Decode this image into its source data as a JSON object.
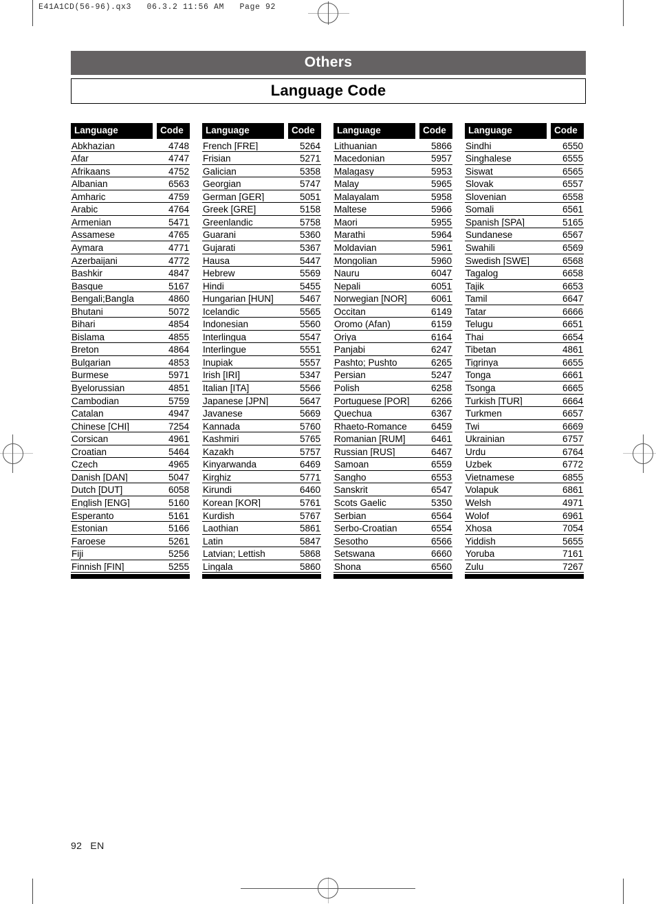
{
  "slug": "E41A1CD(56-96).qx3   06.3.2 11:56 AM   Page 92",
  "header": {
    "section_bar": "Others",
    "title_bar": "Language Code",
    "section_bar_color": "#656263"
  },
  "footer": {
    "page_number": "92",
    "language_code": "EN"
  },
  "table_headers": {
    "language": "Language",
    "code": "Code"
  },
  "columns": [
    {
      "rows": [
        {
          "language": "Abkhazian",
          "code": "4748"
        },
        {
          "language": "Afar",
          "code": "4747"
        },
        {
          "language": "Afrikaans",
          "code": "4752"
        },
        {
          "language": "Albanian",
          "code": "6563"
        },
        {
          "language": "Amharic",
          "code": "4759"
        },
        {
          "language": "Arabic",
          "code": "4764"
        },
        {
          "language": "Armenian",
          "code": "5471"
        },
        {
          "language": "Assamese",
          "code": "4765"
        },
        {
          "language": "Aymara",
          "code": "4771"
        },
        {
          "language": "Azerbaijani",
          "code": "4772"
        },
        {
          "language": "Bashkir",
          "code": "4847"
        },
        {
          "language": "Basque",
          "code": "5167"
        },
        {
          "language": "Bengali;Bangla",
          "code": "4860"
        },
        {
          "language": "Bhutani",
          "code": "5072"
        },
        {
          "language": "Bihari",
          "code": "4854"
        },
        {
          "language": "Bislama",
          "code": "4855"
        },
        {
          "language": "Breton",
          "code": "4864"
        },
        {
          "language": "Bulgarian",
          "code": "4853"
        },
        {
          "language": "Burmese",
          "code": "5971"
        },
        {
          "language": "Byelorussian",
          "code": "4851"
        },
        {
          "language": "Cambodian",
          "code": "5759"
        },
        {
          "language": "Catalan",
          "code": "4947"
        },
        {
          "language": "Chinese [CHI]",
          "code": "7254"
        },
        {
          "language": "Corsican",
          "code": "4961"
        },
        {
          "language": "Croatian",
          "code": "5464"
        },
        {
          "language": "Czech",
          "code": "4965"
        },
        {
          "language": "Danish [DAN]",
          "code": "5047"
        },
        {
          "language": "Dutch [DUT]",
          "code": "6058"
        },
        {
          "language": "English [ENG]",
          "code": "5160"
        },
        {
          "language": "Esperanto",
          "code": "5161"
        },
        {
          "language": "Estonian",
          "code": "5166"
        },
        {
          "language": "Faroese",
          "code": "5261"
        },
        {
          "language": "Fiji",
          "code": "5256"
        },
        {
          "language": "Finnish [FIN]",
          "code": "5255"
        }
      ]
    },
    {
      "rows": [
        {
          "language": "French [FRE]",
          "code": "5264"
        },
        {
          "language": "Frisian",
          "code": "5271"
        },
        {
          "language": "Galician",
          "code": "5358"
        },
        {
          "language": "Georgian",
          "code": "5747"
        },
        {
          "language": "German [GER]",
          "code": "5051"
        },
        {
          "language": "Greek [GRE]",
          "code": "5158"
        },
        {
          "language": "Greenlandic",
          "code": "5758"
        },
        {
          "language": "Guarani",
          "code": "5360"
        },
        {
          "language": "Gujarati",
          "code": "5367"
        },
        {
          "language": "Hausa",
          "code": "5447"
        },
        {
          "language": "Hebrew",
          "code": "5569"
        },
        {
          "language": "Hindi",
          "code": "5455"
        },
        {
          "language": "Hungarian [HUN]",
          "code": "5467"
        },
        {
          "language": "Icelandic",
          "code": "5565"
        },
        {
          "language": "Indonesian",
          "code": "5560"
        },
        {
          "language": "Interlingua",
          "code": "5547"
        },
        {
          "language": "Interlingue",
          "code": "5551"
        },
        {
          "language": "Inupiak",
          "code": "5557"
        },
        {
          "language": "Irish [IRI]",
          "code": "5347"
        },
        {
          "language": "Italian [ITA]",
          "code": "5566"
        },
        {
          "language": "Japanese [JPN]",
          "code": "5647"
        },
        {
          "language": "Javanese",
          "code": "5669"
        },
        {
          "language": "Kannada",
          "code": "5760"
        },
        {
          "language": "Kashmiri",
          "code": "5765"
        },
        {
          "language": "Kazakh",
          "code": "5757"
        },
        {
          "language": "Kinyarwanda",
          "code": "6469"
        },
        {
          "language": "Kirghiz",
          "code": "5771"
        },
        {
          "language": "Kirundi",
          "code": "6460"
        },
        {
          "language": "Korean [KOR]",
          "code": "5761"
        },
        {
          "language": "Kurdish",
          "code": "5767"
        },
        {
          "language": "Laothian",
          "code": "5861"
        },
        {
          "language": "Latin",
          "code": "5847"
        },
        {
          "language": "Latvian; Lettish",
          "code": "5868"
        },
        {
          "language": "Lingala",
          "code": "5860"
        }
      ]
    },
    {
      "rows": [
        {
          "language": "Lithuanian",
          "code": "5866"
        },
        {
          "language": "Macedonian",
          "code": "5957"
        },
        {
          "language": "Malagasy",
          "code": "5953"
        },
        {
          "language": "Malay",
          "code": "5965"
        },
        {
          "language": "Malayalam",
          "code": "5958"
        },
        {
          "language": "Maltese",
          "code": "5966"
        },
        {
          "language": "Maori",
          "code": "5955"
        },
        {
          "language": "Marathi",
          "code": "5964"
        },
        {
          "language": "Moldavian",
          "code": "5961"
        },
        {
          "language": "Mongolian",
          "code": "5960"
        },
        {
          "language": "Nauru",
          "code": "6047"
        },
        {
          "language": "Nepali",
          "code": "6051"
        },
        {
          "language": "Norwegian [NOR]",
          "code": "6061"
        },
        {
          "language": "Occitan",
          "code": "6149"
        },
        {
          "language": "Oromo (Afan)",
          "code": "6159"
        },
        {
          "language": "Oriya",
          "code": "6164"
        },
        {
          "language": "Panjabi",
          "code": "6247"
        },
        {
          "language": "Pashto; Pushto",
          "code": "6265"
        },
        {
          "language": "Persian",
          "code": "5247"
        },
        {
          "language": "Polish",
          "code": "6258"
        },
        {
          "language": "Portuguese [POR]",
          "code": "6266"
        },
        {
          "language": "Quechua",
          "code": "6367"
        },
        {
          "language": "Rhaeto-Romance",
          "code": "6459"
        },
        {
          "language": "Romanian [RUM]",
          "code": "6461"
        },
        {
          "language": "Russian [RUS]",
          "code": "6467"
        },
        {
          "language": "Samoan",
          "code": "6559"
        },
        {
          "language": "Sangho",
          "code": "6553"
        },
        {
          "language": "Sanskrit",
          "code": "6547"
        },
        {
          "language": "Scots Gaelic",
          "code": "5350"
        },
        {
          "language": "Serbian",
          "code": "6564"
        },
        {
          "language": "Serbo-Croatian",
          "code": "6554"
        },
        {
          "language": "Sesotho",
          "code": "6566"
        },
        {
          "language": "Setswana",
          "code": "6660"
        },
        {
          "language": "Shona",
          "code": "6560"
        }
      ]
    },
    {
      "rows": [
        {
          "language": "Sindhi",
          "code": "6550"
        },
        {
          "language": "Singhalese",
          "code": "6555"
        },
        {
          "language": "Siswat",
          "code": "6565"
        },
        {
          "language": "Slovak",
          "code": "6557"
        },
        {
          "language": "Slovenian",
          "code": "6558"
        },
        {
          "language": "Somali",
          "code": "6561"
        },
        {
          "language": "Spanish [SPA]",
          "code": "5165"
        },
        {
          "language": "Sundanese",
          "code": "6567"
        },
        {
          "language": "Swahili",
          "code": "6569"
        },
        {
          "language": "Swedish [SWE]",
          "code": "6568"
        },
        {
          "language": "Tagalog",
          "code": "6658"
        },
        {
          "language": "Tajik",
          "code": "6653"
        },
        {
          "language": "Tamil",
          "code": "6647"
        },
        {
          "language": "Tatar",
          "code": "6666"
        },
        {
          "language": "Telugu",
          "code": "6651"
        },
        {
          "language": "Thai",
          "code": "6654"
        },
        {
          "language": "Tibetan",
          "code": "4861"
        },
        {
          "language": "Tigrinya",
          "code": "6655"
        },
        {
          "language": "Tonga",
          "code": "6661"
        },
        {
          "language": "Tsonga",
          "code": "6665"
        },
        {
          "language": "Turkish [TUR]",
          "code": "6664"
        },
        {
          "language": "Turkmen",
          "code": "6657"
        },
        {
          "language": "Twi",
          "code": "6669"
        },
        {
          "language": "Ukrainian",
          "code": "6757"
        },
        {
          "language": "Urdu",
          "code": "6764"
        },
        {
          "language": "Uzbek",
          "code": "6772"
        },
        {
          "language": "Vietnamese",
          "code": "6855"
        },
        {
          "language": "Volapuk",
          "code": "6861"
        },
        {
          "language": "Welsh",
          "code": "4971"
        },
        {
          "language": "Wolof",
          "code": "6961"
        },
        {
          "language": "Xhosa",
          "code": "7054"
        },
        {
          "language": "Yiddish",
          "code": "5655"
        },
        {
          "language": "Yoruba",
          "code": "7161"
        },
        {
          "language": "Zulu",
          "code": "7267"
        }
      ]
    }
  ]
}
